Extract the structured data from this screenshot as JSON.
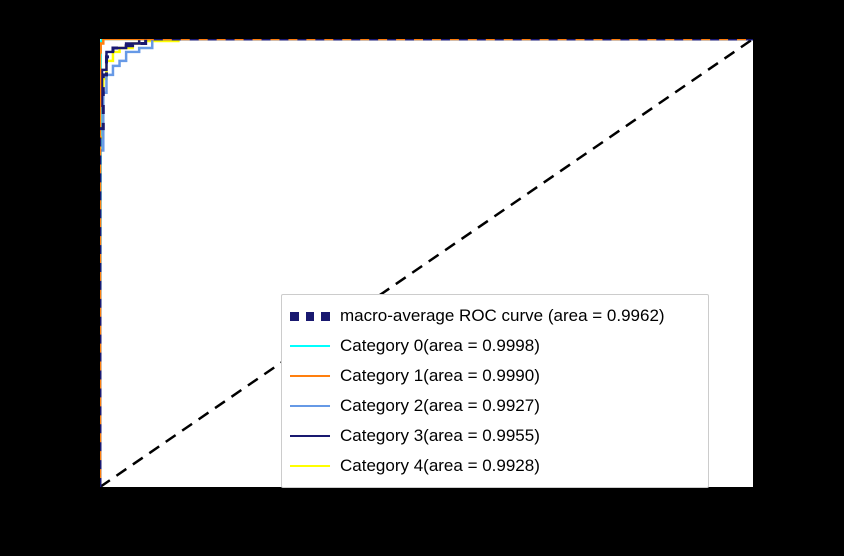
{
  "chart_data": {
    "type": "line",
    "title": "",
    "xlabel": "",
    "ylabel": "",
    "xlim": [
      0.0,
      1.0
    ],
    "ylim": [
      0.0,
      1.0
    ],
    "diagonal": {
      "style": "dashed",
      "color": "#000000",
      "x": [
        0,
        1
      ],
      "y": [
        0,
        1
      ]
    },
    "series": [
      {
        "name": "macro-average ROC curve (area = 0.9962)",
        "style": "dashed",
        "color": "#191970",
        "area": 0.9962,
        "x": [
          0,
          0.005,
          0.01,
          0.02,
          0.03,
          0.05,
          0.07,
          0.1,
          1.0
        ],
        "y": [
          0,
          0.8,
          0.92,
          0.96,
          0.98,
          0.985,
          0.99,
          1.0,
          1.0
        ]
      },
      {
        "name": "Category 0(area = 0.9998)",
        "style": "solid",
        "color": "#00ffff",
        "area": 0.9998,
        "x": [
          0,
          0.001,
          0.003,
          1.0
        ],
        "y": [
          0,
          0.99,
          1.0,
          1.0
        ]
      },
      {
        "name": "Category 1(area = 0.9990)",
        "style": "solid",
        "color": "#ff7f0e",
        "area": 0.999,
        "x": [
          0,
          0.001,
          0.005,
          0.01,
          1.0
        ],
        "y": [
          0,
          0.97,
          0.99,
          1.0,
          1.0
        ]
      },
      {
        "name": "Category 2(area = 0.9927)",
        "style": "solid",
        "color": "#6699e6",
        "area": 0.9927,
        "x": [
          0,
          0.005,
          0.01,
          0.02,
          0.03,
          0.04,
          0.06,
          0.08,
          0.1,
          1.0
        ],
        "y": [
          0,
          0.75,
          0.88,
          0.92,
          0.94,
          0.95,
          0.97,
          0.98,
          1.0,
          1.0
        ]
      },
      {
        "name": "Category 3(area = 0.9955)",
        "style": "solid",
        "color": "#191970",
        "area": 0.9955,
        "x": [
          0,
          0.003,
          0.01,
          0.02,
          0.04,
          0.06,
          0.09,
          1.0
        ],
        "y": [
          0,
          0.85,
          0.93,
          0.97,
          0.98,
          0.99,
          1.0,
          1.0
        ]
      },
      {
        "name": "Category 4(area = 0.9928)",
        "style": "solid",
        "color": "#ffff00",
        "area": 0.9928,
        "x": [
          0,
          0.005,
          0.01,
          0.02,
          0.03,
          0.05,
          0.07,
          0.12,
          1.0
        ],
        "y": [
          0,
          0.78,
          0.91,
          0.95,
          0.97,
          0.98,
          0.99,
          1.0,
          1.0
        ]
      }
    ]
  },
  "legend": {
    "items": [
      {
        "label": "macro-average ROC curve (area = 0.9962)",
        "color": "#191970",
        "style": "dashed"
      },
      {
        "label": "Category 0(area = 0.9998)",
        "color": "#00ffff",
        "style": "solid"
      },
      {
        "label": "Category 1(area = 0.9990)",
        "color": "#ff7f0e",
        "style": "solid"
      },
      {
        "label": "Category 2(area = 0.9927)",
        "color": "#6699e6",
        "style": "solid"
      },
      {
        "label": "Category 3(area = 0.9955)",
        "color": "#191970",
        "style": "solid"
      },
      {
        "label": "Category 4(area = 0.9928)",
        "color": "#ffff00",
        "style": "solid"
      }
    ]
  }
}
